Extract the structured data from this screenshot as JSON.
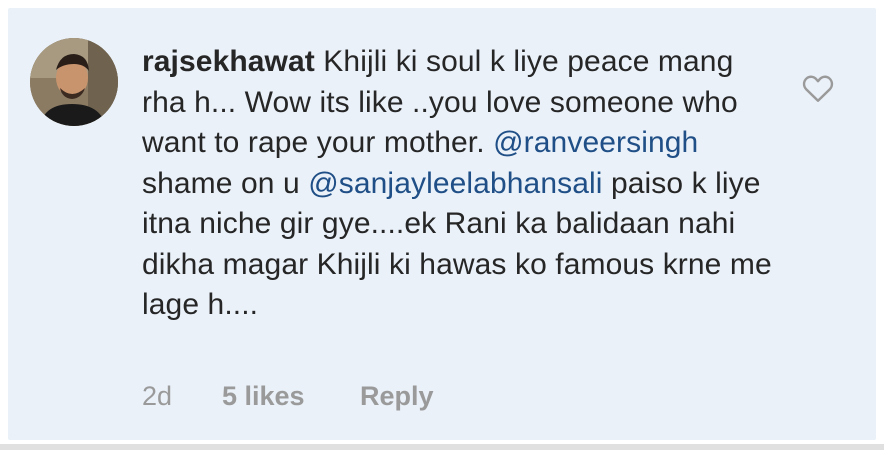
{
  "comment": {
    "username": "rajsekhawat",
    "text_part1": " Khijli ki soul k liye peace mang rha h... Wow its like ..you love someone who want to rape your mother. ",
    "mention1": "@ranveersingh",
    "text_part2": "  shame on u ",
    "mention2": "@sanjayleelabhansali",
    "text_part3": " paiso k liye itna niche gir gye....ek Rani ka balidaan nahi dikha magar Khijli ki hawas ko famous krne me lage h...."
  },
  "meta": {
    "time": "2d",
    "likes": "5 likes",
    "reply": "Reply"
  },
  "icons": {
    "like": "heart-icon",
    "avatar": "profile-photo"
  },
  "colors": {
    "card_background": "#eaf1f9",
    "mention": "#1f4f86",
    "meta_text": "#9a9a9a",
    "body_text": "#262626"
  }
}
